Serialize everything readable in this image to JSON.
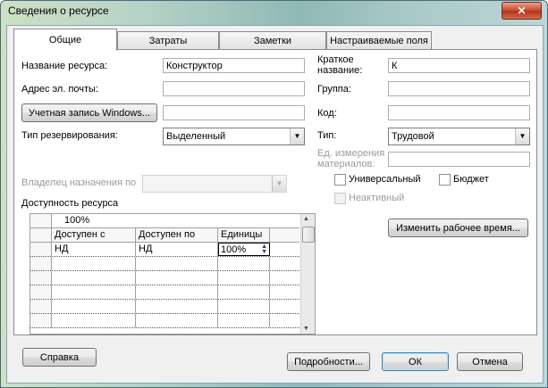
{
  "window": {
    "title": "Сведения о ресурсе",
    "close_glyph": "✕"
  },
  "tabs": [
    {
      "label": "Общие",
      "active": true
    },
    {
      "label": "Затраты",
      "active": false
    },
    {
      "label": "Заметки",
      "active": false
    },
    {
      "label": "Настраиваемые поля",
      "active": false
    }
  ],
  "left": {
    "resource_name_label": "Название ресурса:",
    "resource_name_value": "Конструктор",
    "email_label": "Адрес эл. почты:",
    "email_value": "",
    "windows_account_button": "Учетная запись Windows...",
    "windows_account_value": "",
    "booking_type_label": "Тип резервирования:",
    "booking_type_value": "Выделенный",
    "assignment_owner_label": "Владелец назначения по",
    "assignment_owner_value": ""
  },
  "right": {
    "short_name_label": "Краткое название:",
    "short_name_value": "К",
    "group_label": "Группа:",
    "group_value": "",
    "code_label": "Код:",
    "code_value": "",
    "type_label": "Тип:",
    "type_value": "Трудовой",
    "material_label": "Ед. измерения материалов:",
    "material_value": "",
    "generic_label": "Универсальный",
    "generic_checked": false,
    "budget_label": "Бюджет",
    "budget_checked": false,
    "inactive_label": "Неактивный",
    "inactive_checked": false,
    "change_calendar_button": "Изменить рабочее время..."
  },
  "availability": {
    "label": "Доступность ресурса",
    "edit_value": "100%",
    "columns": [
      "Доступен с",
      "Доступен по",
      "Единицы"
    ],
    "rows": [
      {
        "from": "НД",
        "to": "НД",
        "units": "100%"
      }
    ]
  },
  "footer": {
    "help_button": "Справка",
    "details_button": "Подробности...",
    "ok_button": "ОК",
    "cancel_button": "Отмена"
  }
}
